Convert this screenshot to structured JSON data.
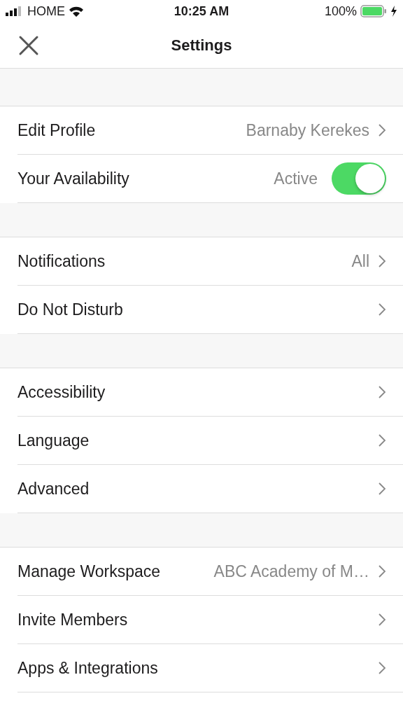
{
  "status_bar": {
    "carrier": "HOME",
    "time": "10:25 AM",
    "battery": "100%"
  },
  "nav": {
    "title": "Settings"
  },
  "sections": [
    {
      "rows": [
        {
          "kind": "link",
          "label": "Edit Profile",
          "value": "Barnaby Kerekes"
        },
        {
          "kind": "toggle",
          "label": "Your Availability",
          "value": "Active",
          "on": true
        }
      ]
    },
    {
      "rows": [
        {
          "kind": "link",
          "label": "Notifications",
          "value": "All"
        },
        {
          "kind": "link",
          "label": "Do Not Disturb"
        }
      ]
    },
    {
      "rows": [
        {
          "kind": "link",
          "label": "Accessibility"
        },
        {
          "kind": "link",
          "label": "Language"
        },
        {
          "kind": "link",
          "label": "Advanced"
        }
      ]
    },
    {
      "rows": [
        {
          "kind": "link",
          "label": "Manage Workspace",
          "value": "ABC Academy of M…"
        },
        {
          "kind": "link",
          "label": "Invite Members"
        },
        {
          "kind": "link",
          "label": "Apps & Integrations"
        }
      ]
    }
  ]
}
